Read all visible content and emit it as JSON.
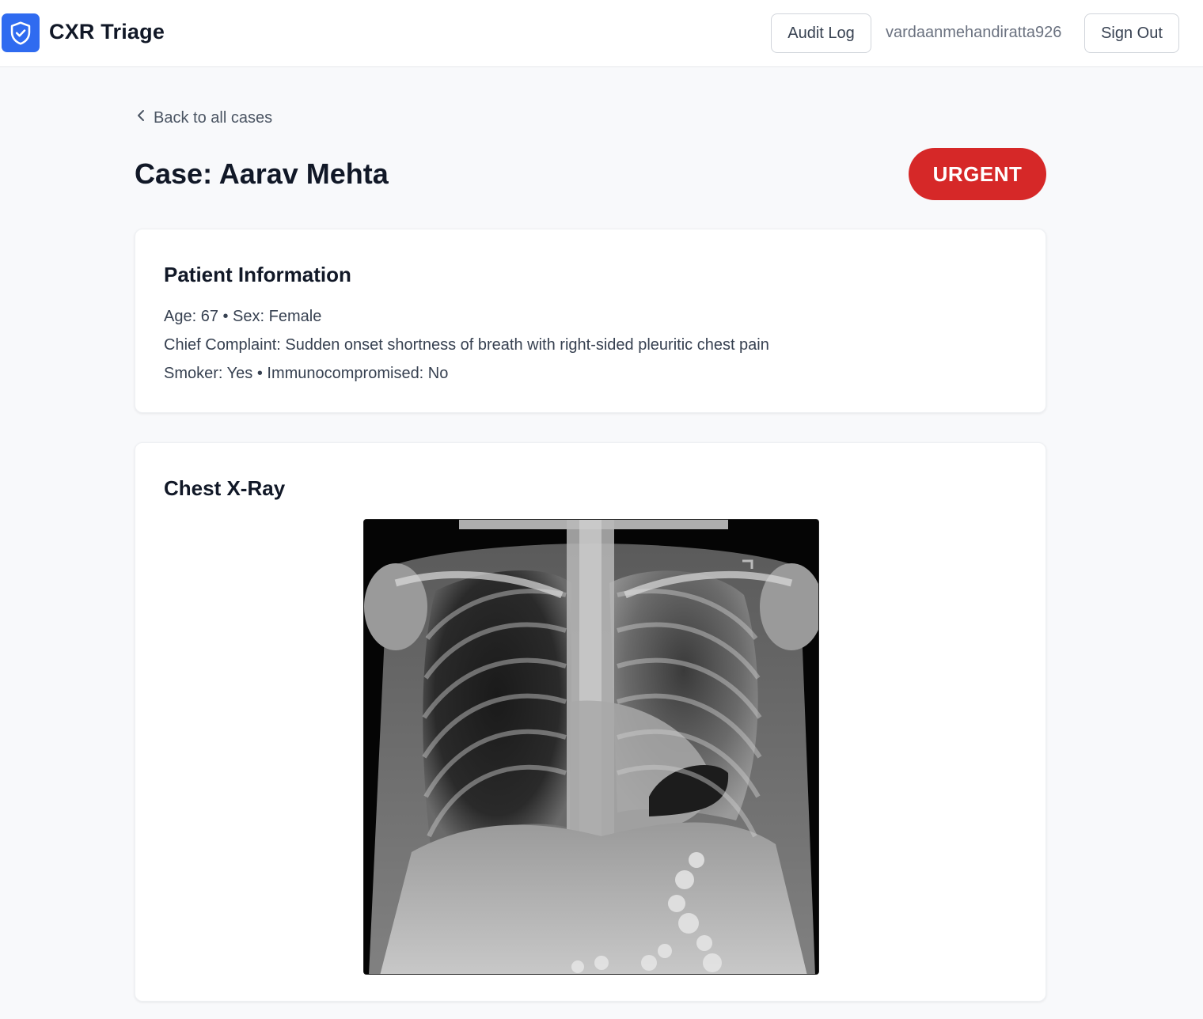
{
  "header": {
    "app_title": "CXR Triage",
    "logo_icon": "shield-check-icon",
    "audit_log_label": "Audit Log",
    "username": "vardaanmehandiratta926",
    "sign_out_label": "Sign Out"
  },
  "nav": {
    "back_label": "Back to all cases",
    "back_icon": "chevron-left-icon"
  },
  "case": {
    "title": "Case: Aarav Mehta",
    "priority_badge": "URGENT",
    "priority_color": "#d62828"
  },
  "patient_info": {
    "heading": "Patient Information",
    "line1": "Age: 67 • Sex: Female",
    "line2": "Chief Complaint: Sudden onset shortness of breath with right-sided pleuritic chest pain",
    "line3": "Smoker: Yes • Immunocompromised: No"
  },
  "xray": {
    "heading": "Chest X-Ray"
  },
  "colors": {
    "accent": "#2f6bf0",
    "urgent": "#d62828",
    "background": "#f8f9fb"
  }
}
